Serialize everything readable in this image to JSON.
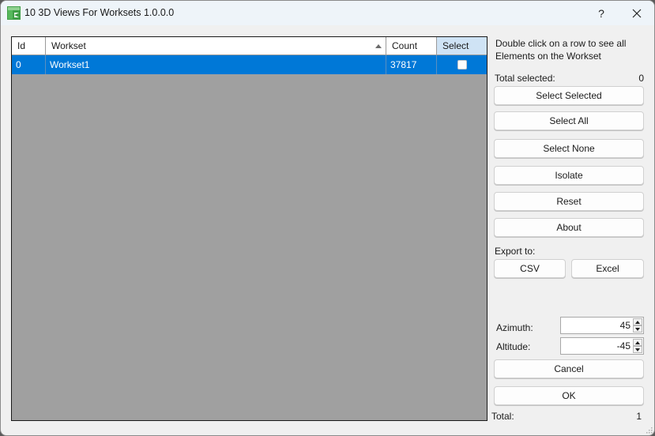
{
  "window": {
    "title": "10 3D Views For Worksets 1.0.0.0",
    "help_label": "?",
    "icons": {
      "app": "app-logo-icon",
      "close": "close-icon"
    }
  },
  "grid": {
    "columns": [
      {
        "label": "Id"
      },
      {
        "label": "Workset",
        "sort": "ascending"
      },
      {
        "label": "Count"
      },
      {
        "label": "Select"
      }
    ],
    "rows": [
      {
        "id": "0",
        "workset": "Workset1",
        "count": "37817",
        "select": false,
        "selected": true
      }
    ]
  },
  "panel": {
    "hint": "Double click on a row to see all Elements on the Workset",
    "total_selected_label": "Total selected:",
    "total_selected_value": "0",
    "buttons": {
      "select_selected": "Select Selected",
      "select_all": "Select All",
      "select_none": "Select None",
      "isolate": "Isolate",
      "reset": "Reset",
      "about": "About"
    },
    "export_label": "Export to:",
    "export_buttons": {
      "csv": "CSV",
      "excel": "Excel"
    },
    "azimuth_label": "Azimuth:",
    "azimuth_value": "45",
    "altitude_label": "Altitude:",
    "altitude_value": "-45",
    "cancel": "Cancel",
    "ok": "OK",
    "total_label": "Total:",
    "total_value": "1"
  },
  "colors": {
    "selection": "#0078d7",
    "grid_background": "#a0a0a0",
    "select_header": "#cfe3f5",
    "logo_green": "#4caf50"
  }
}
